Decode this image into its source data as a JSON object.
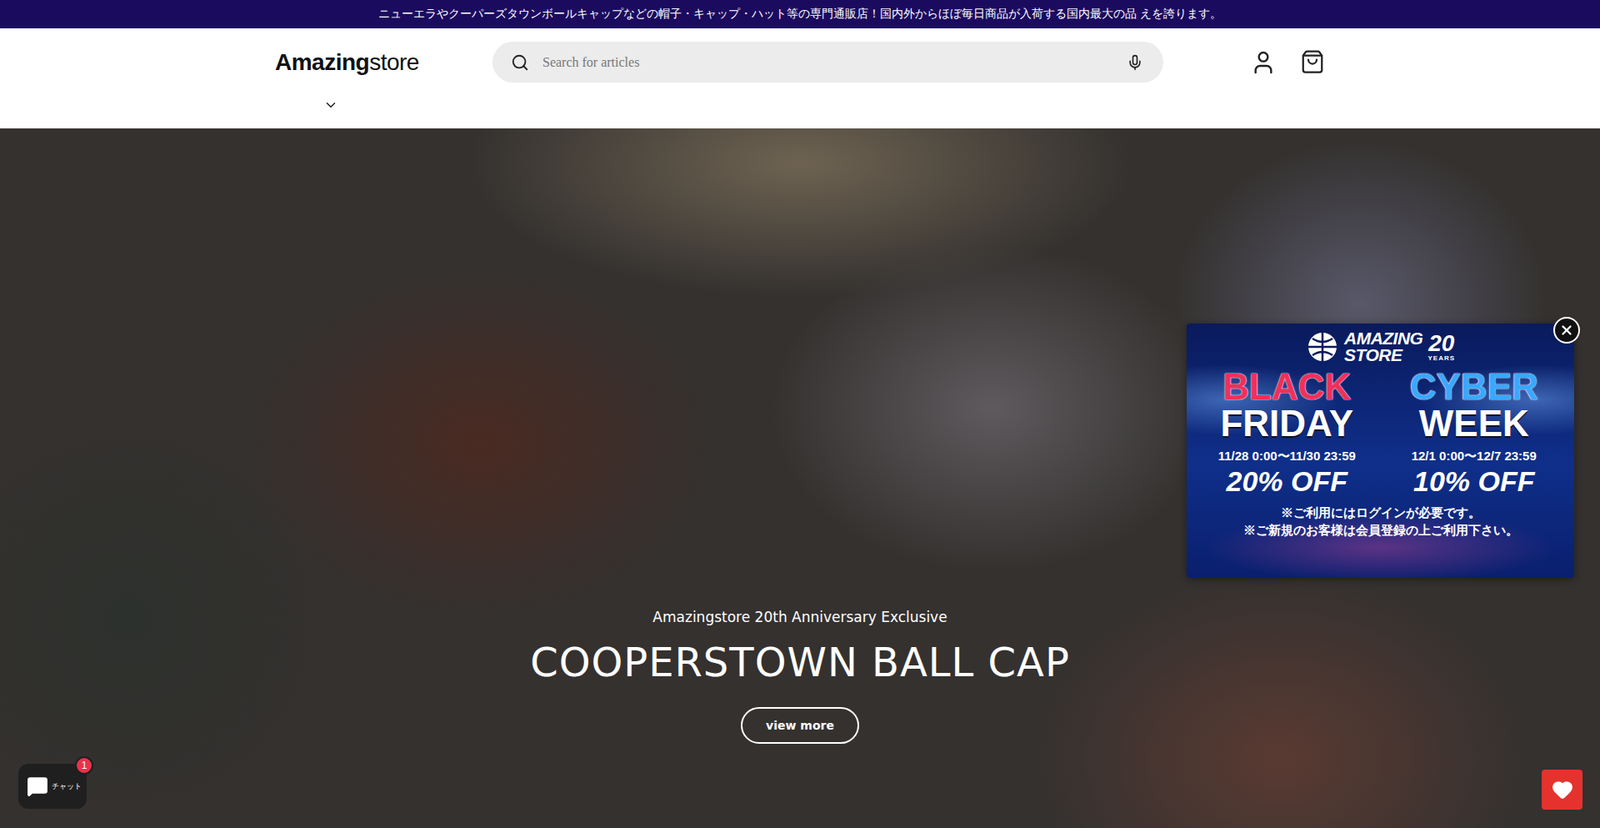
{
  "announcement": "ニューエラやクーパーズタウンボールキャップなどの帽子・キャップ・ハット等の専門通販店！国内外からほぼ毎日商品が入荷する国内最大の品 えを誇ります。",
  "logo": {
    "bold": "Amazing",
    "light": "store"
  },
  "search": {
    "placeholder": "Search for articles"
  },
  "hero": {
    "eyebrow": "Amazingstore 20th Anniversary Exclusive",
    "title": "COOPERSTOWN BALL CAP",
    "button": "view more"
  },
  "popup": {
    "brand": {
      "top": "AMAZING",
      "bottom": "STORE",
      "number": "20",
      "unit": "YEARS"
    },
    "campaigns": [
      {
        "top": "BLACK",
        "bottom": "FRIDAY",
        "dates": "11/28 0:00〜11/30 23:59",
        "discount": "20% OFF",
        "color": "#f0305a"
      },
      {
        "top": "CYBER",
        "bottom": "WEEK",
        "dates": "12/1 0:00〜12/7 23:59",
        "discount": "10% OFF",
        "color": "#39a8ff"
      }
    ],
    "notes": [
      "※ご利用にはログインが必要です。",
      "※ご新規のお客様は会員登録の上ご利用下さい。"
    ]
  },
  "chat": {
    "badge": "1",
    "label": "チャット"
  }
}
